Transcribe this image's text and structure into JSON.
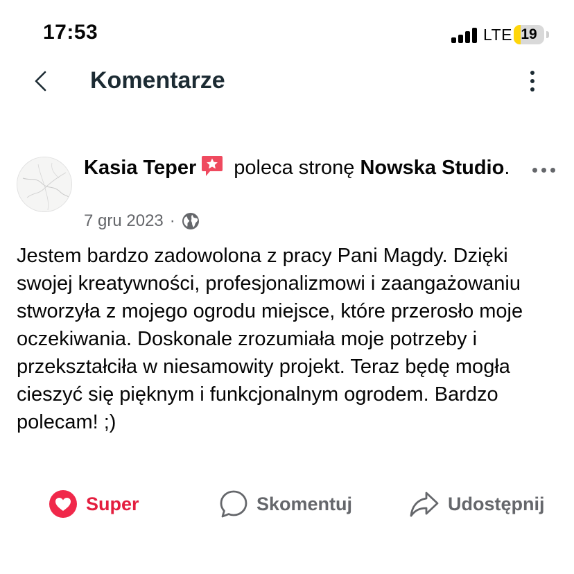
{
  "status_bar": {
    "time": "17:53",
    "network": "LTE",
    "battery": "19",
    "battery_level": 0.19
  },
  "header": {
    "title": "Komentarze"
  },
  "post": {
    "author": "Kasia Teper",
    "action_text": "poleca stronę",
    "page_name": "Nowska Studio",
    "page_suffix": ".",
    "date": "7 gru 2023",
    "separator": "·",
    "body": "Jestem bardzo zadowolona z pracy Pani Magdy. Dzięki swojej kreatywności, profesjonalizmowi i zaangażowaniu stworzyła z mojego ogrodu miejsce, które przerosło moje oczekiwania. Doskonale zrozumiała moje potrzeby i przekształciła w niesamowity projekt. Teraz będę mogła cieszyć się pięknym i funkcjonalnym ogrodem. Bardzo polecam! ;)"
  },
  "actions": {
    "react_label": "Super",
    "comment_label": "Skomentuj",
    "share_label": "Udostępnij"
  },
  "colors": {
    "reaction": "#e41e3f",
    "secondary_text": "#65676b",
    "title_text": "#1c2b33",
    "battery_fill": "#ffd60a"
  },
  "icons": {
    "back": "chevron-left-icon",
    "menu": "vertical-dots-icon",
    "badge": "recommendation-star-icon",
    "privacy": "globe-icon",
    "post_menu": "horizontal-dots-icon",
    "react": "heart-icon",
    "comment": "speech-bubble-icon",
    "share": "share-arrow-icon"
  }
}
